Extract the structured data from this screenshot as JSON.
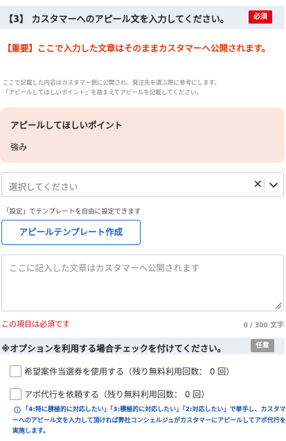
{
  "section": {
    "title": "【3】 カスタマーへのアピール文を入力してください。",
    "required_badge": "必須"
  },
  "warning": "【重要】ここで入力した文章はそのままカスタマーへ公開されます。",
  "note": {
    "line1": "ここで記載した内容はカスタマー側に公開され、発注先を選ぶ際に参考にします。",
    "line2": "「アピールしてほしいポイント」を踏まえてアピールを記載してください。"
  },
  "appeal_point": {
    "label": "アピールしてほしいポイント",
    "value": "強み"
  },
  "template_select": {
    "placeholder": "選択してください",
    "clear_icon": "close-icon",
    "chevron_icon": "chevron-down-icon"
  },
  "template_note": "「設定」でテンプレートを自由に設定できます",
  "template_button": "アピールテンプレート作成",
  "appeal_text": {
    "value": "",
    "placeholder": "ここに記入した文章はカスタマーへ公開されます"
  },
  "validation": {
    "required_message": "この項目は必須です",
    "char_count": "0 / 300 文字"
  },
  "options": {
    "title": "※オプションを利用する場合チェックを付けてください。",
    "optional_badge": "任意",
    "items": [
      {
        "label": "希望案件当選券を使用する（残り無料利用回数： 0 回）",
        "checked": false
      },
      {
        "label": "アポ代行を依頼する（残り無料利用回数： 0 回）",
        "checked": false
      }
    ],
    "info_icon": "info-icon",
    "info_text": "「4:特に積極的に対応したい」「3:積極的に対応したい」「2:対応したい」で挙手し、カスタマーへのアピール文を入力して頂ければ弊社コンシェルジュがカスタマーにアピールしてアポ代行を実施します。"
  },
  "colors": {
    "accent_blue": "#2e6dd8",
    "required_red": "#e60012",
    "warning_orange": "#e8380d",
    "section_bg": "#e9eef5",
    "point_bg": "#fce5df",
    "optional_gray": "#9a9a9a"
  }
}
